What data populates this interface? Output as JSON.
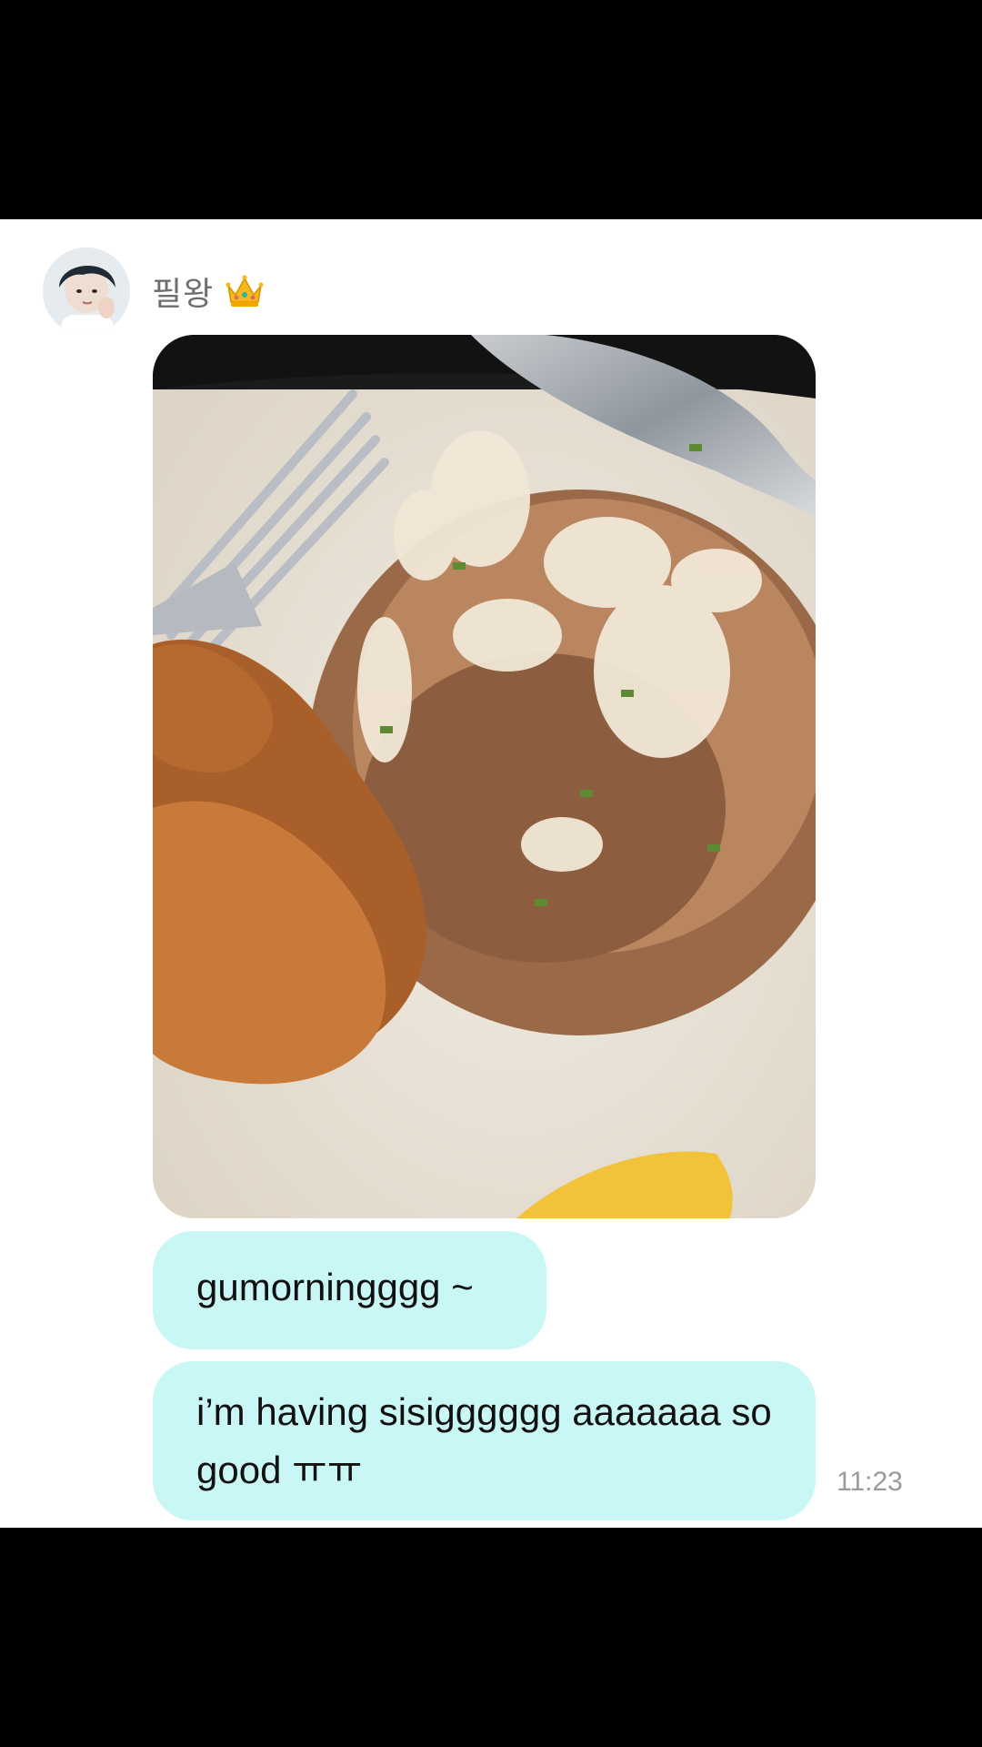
{
  "conversation": {
    "sender": {
      "name": "필왕",
      "badge_icon": "crown-icon",
      "avatar_icon": "avatar-photo"
    },
    "messages": [
      {
        "type": "image",
        "description_icon": "food-photo"
      },
      {
        "type": "text",
        "text": "gumorningggg ~"
      },
      {
        "type": "text",
        "text": "i’m having sisigggggg aaaaaaa so good ㅠㅠ",
        "time": "11:23"
      }
    ]
  },
  "colors": {
    "bubble": "#c9f7f5",
    "background": "#ffffff",
    "system_bars": "#000000",
    "timestamp": "#9a9a9a"
  }
}
